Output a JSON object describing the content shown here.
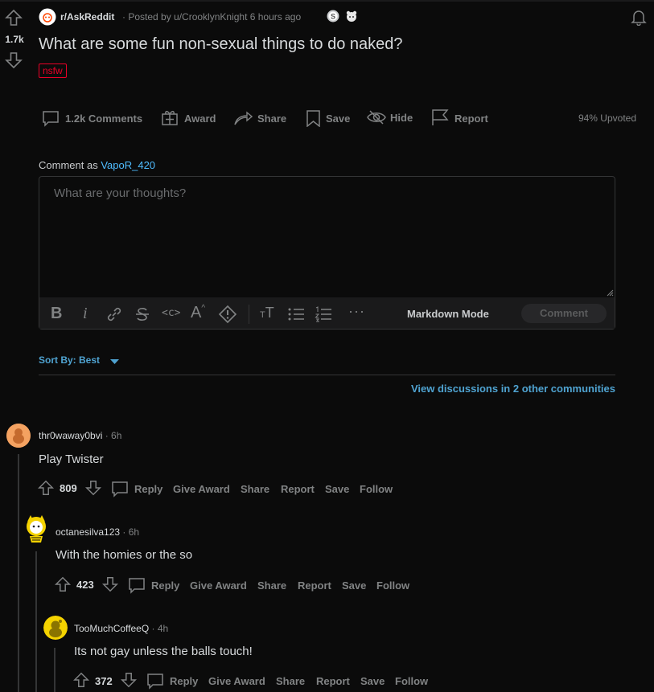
{
  "post": {
    "subreddit": "r/AskReddit",
    "posted_by": "· Posted by u/CrooklynKnight 6 hours ago",
    "votes": "1.7k",
    "title": "What are some fun non-sexual things to do naked?",
    "flair": "nsfw",
    "actions": {
      "comments": "1.2k Comments",
      "award": "Award",
      "share": "Share",
      "save": "Save",
      "hide": "Hide",
      "report": "Report"
    },
    "upvoted": "94% Upvoted"
  },
  "comment_box": {
    "comment_as_prefix": "Comment as",
    "username": "VapoR_420",
    "placeholder": "What are your thoughts?",
    "markdown_mode": "Markdown Mode",
    "comment_button": "Comment"
  },
  "sort": {
    "label": "Sort By: Best"
  },
  "view_discussions": "View discussions in 2 other communities",
  "comments": [
    {
      "author": "thr0waway0bvi",
      "time": "· 6h",
      "body": "Play Twister",
      "votes": "809",
      "actions": [
        "Reply",
        "Give Award",
        "Share",
        "Report",
        "Save",
        "Follow"
      ]
    },
    {
      "author": "octanesilva123",
      "time": "· 6h",
      "body": "With the homies or the so",
      "votes": "423",
      "actions": [
        "Reply",
        "Give Award",
        "Share",
        "Report",
        "Save",
        "Follow"
      ]
    },
    {
      "author": "TooMuchCoffeeQ",
      "time": "· 4h",
      "body": "Its not gay unless the balls touch!",
      "votes": "372",
      "actions": [
        "Reply",
        "Give Award",
        "Share",
        "Report",
        "Save",
        "Follow"
      ]
    }
  ],
  "colors": {
    "background": "#0b0b0b",
    "link_blue": "#4fbcff",
    "sort_blue": "#4fa3d1",
    "flair_red": "#ea0027",
    "muted": "#818384"
  }
}
